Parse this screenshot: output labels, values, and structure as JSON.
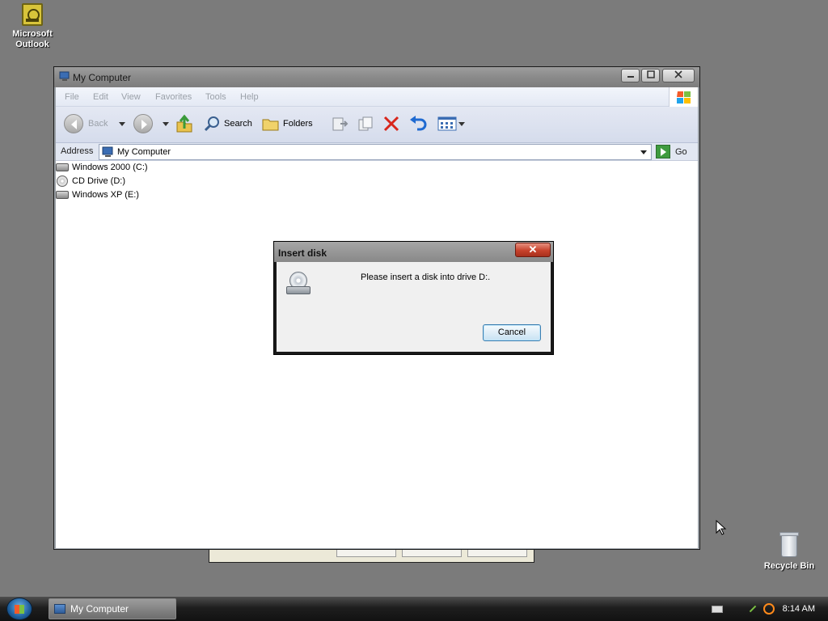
{
  "desktop": {
    "icons": [
      {
        "label": "Microsoft Outlook",
        "icon": "outlook-icon"
      },
      {
        "label": "Recycle Bin",
        "icon": "recycle-bin-icon"
      }
    ]
  },
  "window": {
    "title": "My Computer",
    "menu": [
      "File",
      "Edit",
      "View",
      "Favorites",
      "Tools",
      "Help"
    ],
    "toolbar": {
      "back_label": "Back",
      "search_label": "Search",
      "folders_label": "Folders"
    },
    "address": {
      "label": "Address",
      "value": "My Computer",
      "go_label": "Go"
    },
    "drives": [
      {
        "label": "Windows 2000 (C:)",
        "icon": "hard-drive-icon"
      },
      {
        "label": "CD Drive (D:)",
        "icon": "cd-drive-icon"
      },
      {
        "label": "Windows XP (E:)",
        "icon": "hard-drive-icon"
      }
    ]
  },
  "dialog": {
    "title": "Insert disk",
    "message": "Please insert a disk into drive D:.",
    "cancel_label": "Cancel",
    "close_glyph": "✕"
  },
  "taskbar": {
    "task_label": "My Computer",
    "clock": "8:14 AM"
  }
}
